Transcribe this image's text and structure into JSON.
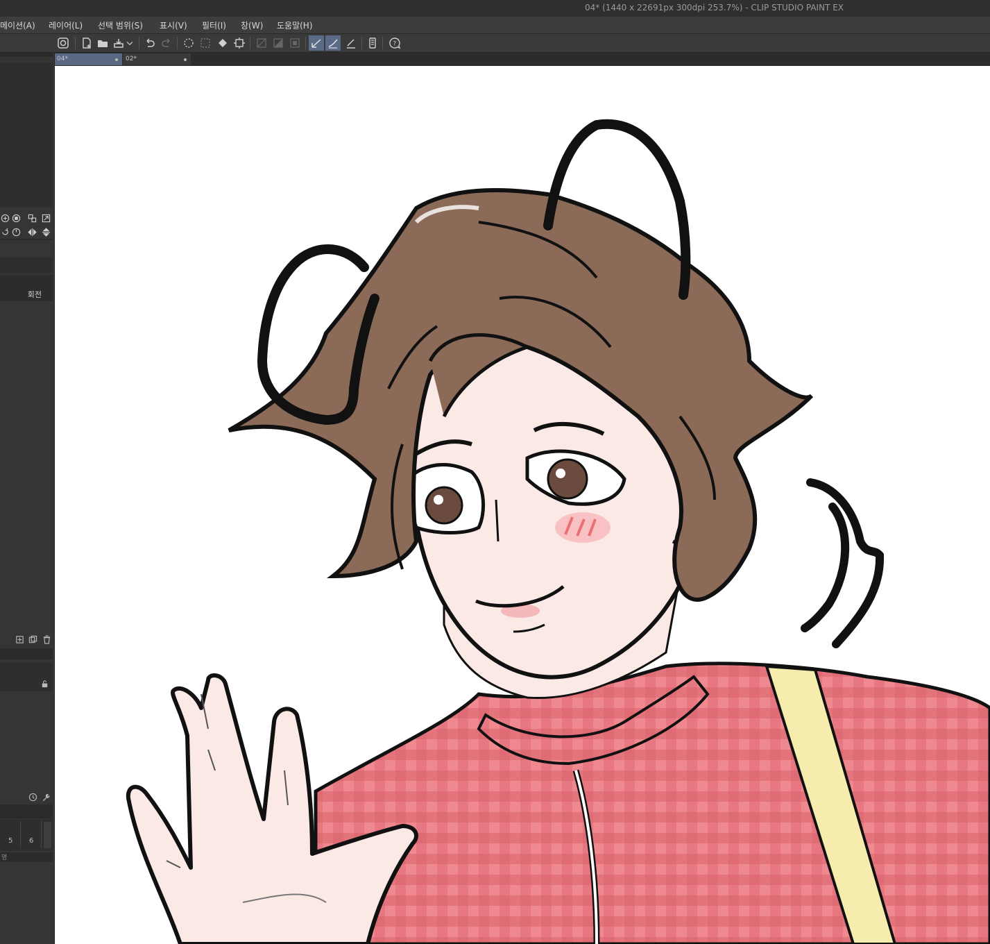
{
  "window": {
    "title": "04* (1440 x 22691px 300dpi 253.7%)  - CLIP STUDIO PAINT EX"
  },
  "menu": [
    "메이션(A)",
    "레이어(L)",
    "선택 범위(S)",
    "표시(V)",
    "필터(I)",
    "창(W)",
    "도움말(H)"
  ],
  "tabs": [
    {
      "label": "04*",
      "active": true
    },
    {
      "label": "02*",
      "active": false
    }
  ],
  "left_panel": {
    "rotate_label": "회전",
    "numbers": [
      "5",
      "6"
    ],
    "bottom_label": "명"
  },
  "toolbar_icons": [
    "clip-studio-icon",
    "new-file-icon",
    "open-file-icon",
    "save-icon",
    "undo-icon",
    "redo-icon",
    "transform-icon",
    "select-icon",
    "fill-icon",
    "crop-icon",
    "ruler-icon",
    "snap-icon",
    "grid-icon",
    "pen-mode-icon",
    "stroke-icon",
    "eraser-icon",
    "device-icon",
    "help-icon"
  ],
  "colors": {
    "accent": "#5b6a86",
    "shirt": "#e8707a",
    "hair": "#8c6a58",
    "skin": "#fbe9e6",
    "strap": "#f6ecae"
  }
}
